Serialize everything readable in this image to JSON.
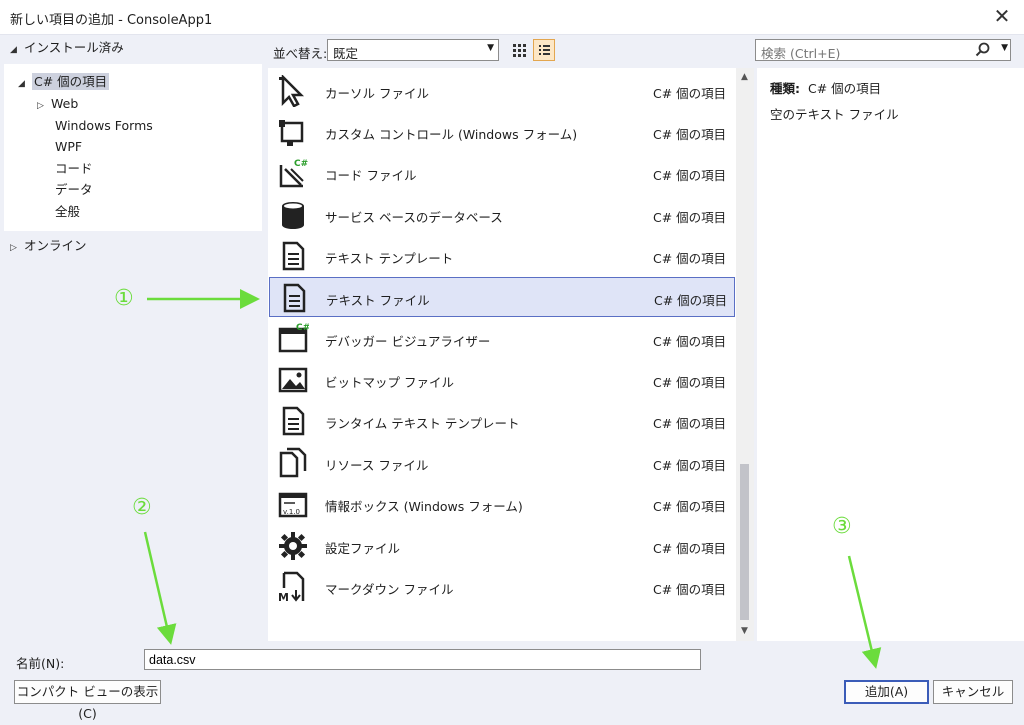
{
  "window": {
    "title": "新しい項目の追加 - ConsoleApp1"
  },
  "left_tree": {
    "installed": "インストール済み",
    "csharp": "C# 個の項目",
    "children": [
      "Web",
      "Windows Forms",
      "WPF",
      "コード",
      "データ",
      "全般"
    ],
    "online": "オンライン"
  },
  "toolbar": {
    "sort_label": "並べ替え:",
    "sort_value": "既定",
    "search_placeholder": "検索 (Ctrl+E)"
  },
  "items": [
    {
      "name": "カーソル ファイル",
      "category": "C# 個の項目",
      "icon": "cursor-icon"
    },
    {
      "name": "カスタム コントロール (Windows フォーム)",
      "category": "C# 個の項目",
      "icon": "custom-control-icon"
    },
    {
      "name": "コード ファイル",
      "category": "C# 個の項目",
      "icon": "code-file-icon"
    },
    {
      "name": "サービス ベースのデータベース",
      "category": "C# 個の項目",
      "icon": "database-icon"
    },
    {
      "name": "テキスト テンプレート",
      "category": "C# 個の項目",
      "icon": "text-template-icon"
    },
    {
      "name": "テキスト ファイル",
      "category": "C# 個の項目",
      "icon": "text-file-icon",
      "selected": true
    },
    {
      "name": "デバッガー ビジュアライザー",
      "category": "C# 個の項目",
      "icon": "debugger-visualizer-icon"
    },
    {
      "name": "ビットマップ ファイル",
      "category": "C# 個の項目",
      "icon": "bitmap-icon"
    },
    {
      "name": "ランタイム テキスト テンプレート",
      "category": "C# 個の項目",
      "icon": "runtime-template-icon"
    },
    {
      "name": "リソース ファイル",
      "category": "C# 個の項目",
      "icon": "resource-file-icon"
    },
    {
      "name": "情報ボックス (Windows フォーム)",
      "category": "C# 個の項目",
      "icon": "about-box-icon"
    },
    {
      "name": "設定ファイル",
      "category": "C# 個の項目",
      "icon": "settings-gear-icon"
    },
    {
      "name": "マークダウン ファイル",
      "category": "C# 個の項目",
      "icon": "markdown-icon"
    }
  ],
  "details": {
    "type_label": "種類:",
    "type_value": "C# 個の項目",
    "description": "空のテキスト ファイル"
  },
  "bottom": {
    "name_label": "名前(N):",
    "name_value": "data.csv",
    "compact_button": "コンパクト ビューの表示(C)",
    "add_button": "追加(A)",
    "cancel_button": "キャンセル"
  },
  "annotations": {
    "step1": "①",
    "step2": "②",
    "step3": "③",
    "color": "#6bdc3c"
  }
}
